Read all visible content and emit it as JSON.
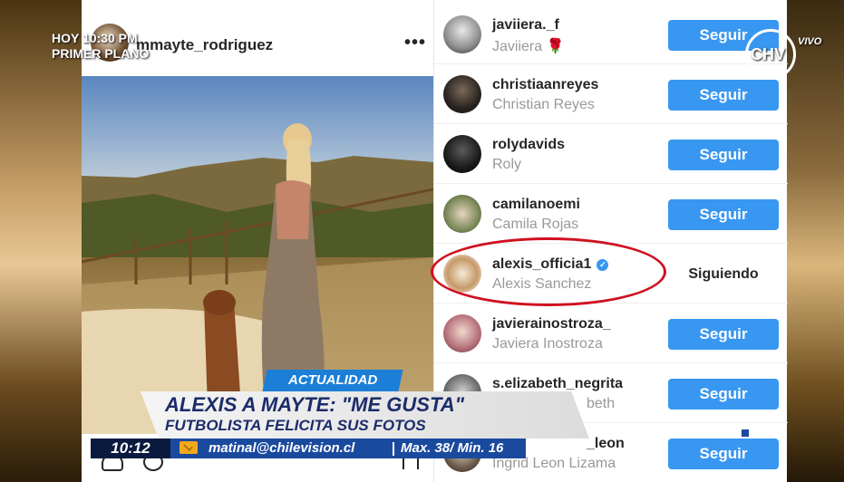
{
  "broadcast": {
    "show_line1": "HOY 10:30 PM",
    "show_line2": "PRIMER PLANO",
    "channel_logo": "CHV",
    "live_label": "VIVO",
    "section_tag": "ACTUALIDAD",
    "headline": "ALEXIS A MAYTE: \"ME GUSTA\"",
    "subheadline": "FUTBOLISTA FELICITA SUS FOTOS",
    "clock": "10:12",
    "email": "matinal@chilevision.cl",
    "weather": "Max. 38/ Min. 16"
  },
  "post": {
    "username": "mmayte_rodriguez",
    "more_icon": "more-options-icon",
    "more_label": "•••"
  },
  "follow_list": [
    {
      "username": "javiiera._f",
      "full_name": "Javiiera 🌹",
      "action": "Seguir",
      "following": false
    },
    {
      "username": "christiaanreyes",
      "full_name": "Christian Reyes",
      "action": "Seguir",
      "following": false
    },
    {
      "username": "rolydavids",
      "full_name": "Roly",
      "action": "Seguir",
      "following": false
    },
    {
      "username": "camilanoemi",
      "full_name": "Camila Rojas",
      "action": "Seguir",
      "following": false
    },
    {
      "username": "alexis_officia1",
      "full_name": "Alexis Sanchez",
      "action": "Siguiendo",
      "following": true,
      "verified": true
    },
    {
      "username": "javierainostroza_",
      "full_name": "Javiera Inostroza",
      "action": "Seguir",
      "following": false
    },
    {
      "username": "s.elizabeth_negrita",
      "full_name": "beth",
      "action": "Seguir",
      "following": false
    },
    {
      "username": "_leon",
      "full_name": "Ingrid Leon Lizama",
      "action": "Seguir",
      "following": false
    }
  ],
  "colors": {
    "button_blue": "#3897f0",
    "highlight_ring": "#d01020",
    "ticker_blue": "#1a4a9e",
    "headline_navy": "#1c2c6a"
  }
}
